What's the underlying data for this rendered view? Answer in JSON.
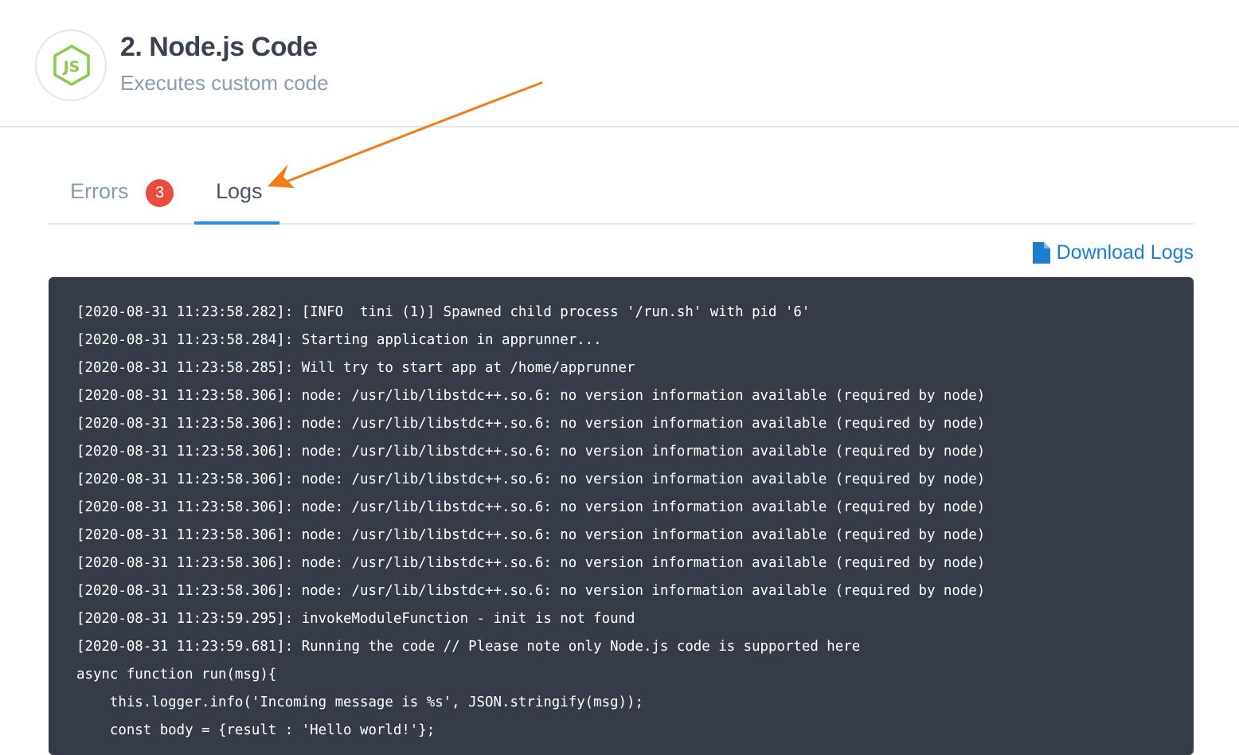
{
  "step": {
    "title": "2. Node.js Code",
    "subtitle": "Executes custom code",
    "icon": "nodejs-icon",
    "icon_color": "#8cc84b"
  },
  "tabs": [
    {
      "label": "Errors",
      "badge": "3",
      "active": false
    },
    {
      "label": "Logs",
      "active": true
    }
  ],
  "download": {
    "label": "Download Logs",
    "icon": "file-icon"
  },
  "log_lines": [
    "[2020-08-31 11:23:58.282]: [INFO  tini (1)] Spawned child process '/run.sh' with pid '6'",
    "[2020-08-31 11:23:58.284]: Starting application in apprunner...",
    "[2020-08-31 11:23:58.285]: Will try to start app at /home/apprunner",
    "[2020-08-31 11:23:58.306]: node: /usr/lib/libstdc++.so.6: no version information available (required by node)",
    "[2020-08-31 11:23:58.306]: node: /usr/lib/libstdc++.so.6: no version information available (required by node)",
    "[2020-08-31 11:23:58.306]: node: /usr/lib/libstdc++.so.6: no version information available (required by node)",
    "[2020-08-31 11:23:58.306]: node: /usr/lib/libstdc++.so.6: no version information available (required by node)",
    "[2020-08-31 11:23:58.306]: node: /usr/lib/libstdc++.so.6: no version information available (required by node)",
    "[2020-08-31 11:23:58.306]: node: /usr/lib/libstdc++.so.6: no version information available (required by node)",
    "[2020-08-31 11:23:58.306]: node: /usr/lib/libstdc++.so.6: no version information available (required by node)",
    "[2020-08-31 11:23:58.306]: node: /usr/lib/libstdc++.so.6: no version information available (required by node)",
    "[2020-08-31 11:23:59.295]: invokeModuleFunction - init is not found",
    "[2020-08-31 11:23:59.681]: Running the code // Please note only Node.js code is supported here",
    "async function run(msg){",
    "    this.logger.info('Incoming message is %s', JSON.stringify(msg));",
    "    const body = {result : 'Hello world!'};"
  ],
  "colors": {
    "accent": "#2a8fdc",
    "badge": "#ea4d3d",
    "panel_bg": "#363c47",
    "annotation_arrow": "#f07c1a"
  }
}
